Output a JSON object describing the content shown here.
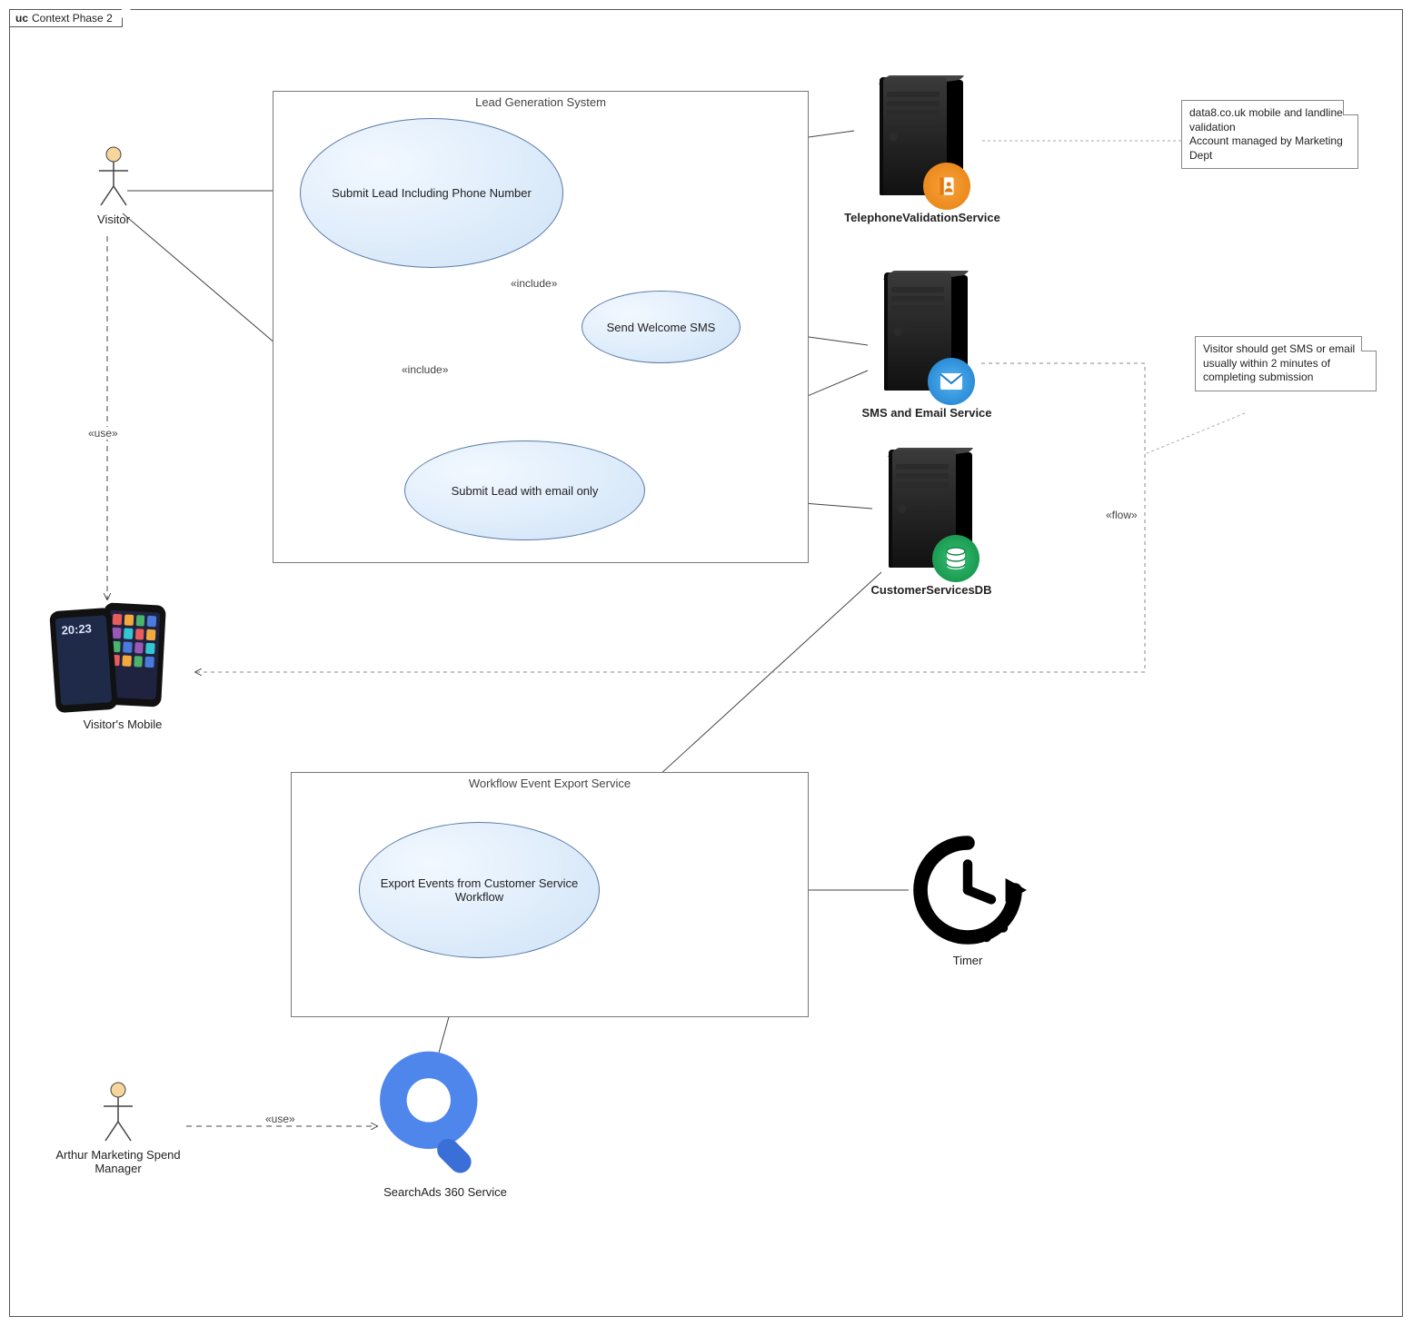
{
  "frame": {
    "title_prefix": "uc",
    "title": "Context Phase 2"
  },
  "boundaries": {
    "leadgen": {
      "title": "Lead Generation System"
    },
    "workflow": {
      "title": "Workflow Event Export Service"
    }
  },
  "usecases": {
    "submit_phone": "Submit Lead Including Phone Number",
    "send_sms": "Send Welcome SMS",
    "submit_email": "Submit Lead with email only",
    "export_events": "Export Events from Customer Service Workflow"
  },
  "actors": {
    "visitor": "Visitor",
    "arthur": "Arthur Marketing Spend Manager"
  },
  "nodes": {
    "tvs": "TelephoneValidationService",
    "sms_email": "SMS and Email Service",
    "csdb": "CustomerServicesDB",
    "mobile": "Visitor's Mobile",
    "timer": "Timer",
    "searchads": "SearchAds 360 Service"
  },
  "notes": {
    "tvs_note": "data8.co.uk mobile and landline validation\nAccount managed by Marketing Dept",
    "flow_note": "Visitor should get SMS or email usually within 2 minutes of completing submission"
  },
  "edge_labels": {
    "include": "«include»",
    "use": "«use»",
    "flow": "«flow»"
  },
  "mobile_time": "20:23"
}
